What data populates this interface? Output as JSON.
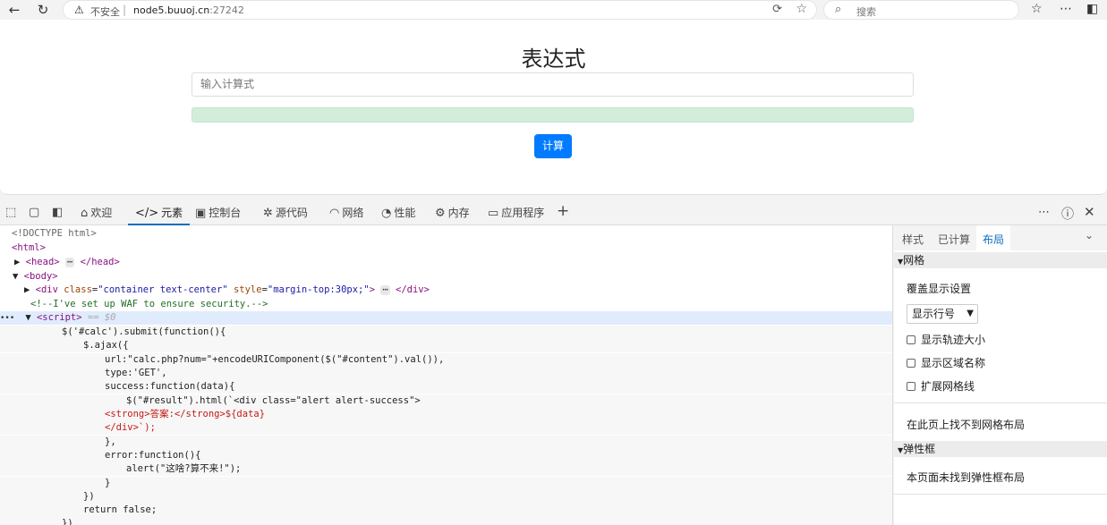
{
  "browser": {
    "back_icon": "arrow-left-icon",
    "reload_icon": "refresh-icon",
    "security_label": "不安全",
    "url_host": "node5.buuoj.cn",
    "url_port": ":27242",
    "search_placeholder": "搜索"
  },
  "page": {
    "title": "表达式",
    "input_placeholder": "输入计算式",
    "submit_label": "计算",
    "button_color": "#007bff",
    "result_color": "#d4edda"
  },
  "devtools": {
    "tabs": [
      {
        "label": "欢迎",
        "icon": "home-icon"
      },
      {
        "label": "元素",
        "icon": "code-icon"
      },
      {
        "label": "控制台",
        "icon": "console-icon"
      },
      {
        "label": "源代码",
        "icon": "bug-icon"
      },
      {
        "label": "网络",
        "icon": "wifi-icon"
      },
      {
        "label": "性能",
        "icon": "gauge-icon"
      },
      {
        "label": "内存",
        "icon": "memory-icon"
      },
      {
        "label": "应用程序",
        "icon": "app-icon"
      }
    ],
    "add_tab": "+",
    "accent_color": "#0f6cbd",
    "source": {
      "doctype": "<!DOCTYPE html>",
      "html_tag": "<html>",
      "head_open": "<head>",
      "head_close": "</head>",
      "body_tag": "<body>",
      "div_open": "<div",
      "div_class_attr": "class",
      "div_class_val": "\"container text-center\"",
      "div_style_attr": "style",
      "div_style_val": "\"margin-top:30px;\"",
      "div_close": "</div>",
      "comment": "<!--I've set up WAF to ensure security.-->",
      "script_tag": "<script>",
      "script_marker": "== $0",
      "gutter_dots": "•••",
      "ellipsis": "⋯",
      "js_lines": [
        "$('#calc').submit(function(){",
        "$.ajax({",
        "url:\"calc.php?num=\"+encodeURIComponent($(\"#content\").val()),",
        "type:'GET',",
        "success:function(data){",
        "$(\"#result\").html(`<div class=\"alert alert-success\">",
        "<strong>答案:</strong>${data}",
        "</div>`);",
        "},",
        "error:function(){",
        "alert(\"这啥?算不来!\");",
        "}",
        "})",
        "return false;",
        "})"
      ]
    },
    "side": {
      "tabs": [
        "样式",
        "已计算",
        "布局"
      ],
      "grid_header": "网格",
      "overlay_label": "覆盖显示设置",
      "select_value": "显示行号",
      "checkboxes": [
        "显示轨迹大小",
        "显示区域名称",
        "扩展网格线"
      ],
      "no_grid": "在此页上找不到网格布局",
      "flex_header": "弹性框",
      "no_flex": "本页面未找到弹性框布局"
    }
  }
}
